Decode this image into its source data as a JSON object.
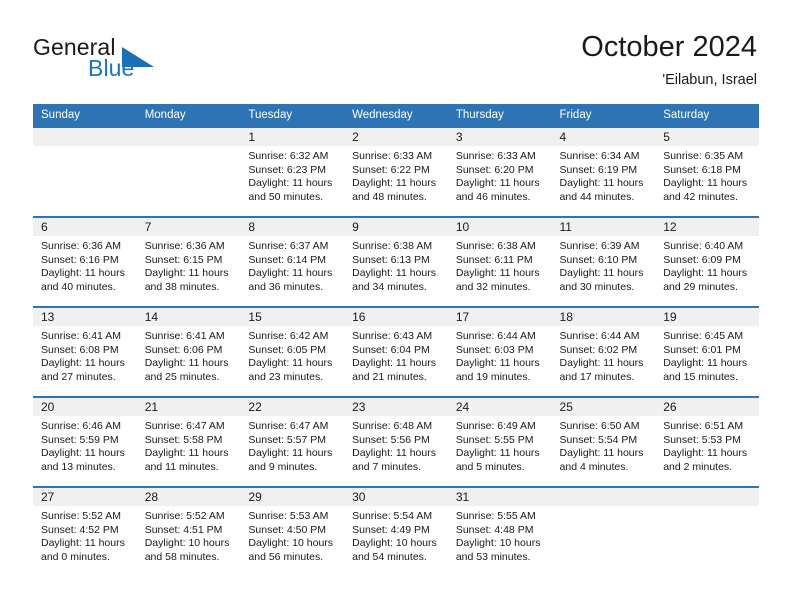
{
  "logo": {
    "word_one": "General",
    "word_two": "Blue",
    "triangle_color": "#1b6fb5",
    "text_color": "#1a1a1a",
    "blue_color": "#1b75bb",
    "icon": "general-blue-logo"
  },
  "header": {
    "title": "October 2024",
    "subtitle": "'Eilabun, Israel",
    "accent_color": "#2e74b5",
    "day_band_color": "#f0f0f0"
  },
  "weekday_headers": [
    "Sunday",
    "Monday",
    "Tuesday",
    "Wednesday",
    "Thursday",
    "Friday",
    "Saturday"
  ],
  "labels": {
    "sunrise_prefix": "Sunrise:",
    "sunset_prefix": "Sunset:",
    "daylight_prefix": "Daylight:"
  },
  "weeks": [
    [
      {
        "day": "",
        "empty": true
      },
      {
        "day": "",
        "empty": true
      },
      {
        "day": "1",
        "sunrise": "Sunrise: 6:32 AM",
        "sunset": "Sunset: 6:23 PM",
        "daylight_line1": "Daylight: 11 hours",
        "daylight_line2": "and 50 minutes."
      },
      {
        "day": "2",
        "sunrise": "Sunrise: 6:33 AM",
        "sunset": "Sunset: 6:22 PM",
        "daylight_line1": "Daylight: 11 hours",
        "daylight_line2": "and 48 minutes."
      },
      {
        "day": "3",
        "sunrise": "Sunrise: 6:33 AM",
        "sunset": "Sunset: 6:20 PM",
        "daylight_line1": "Daylight: 11 hours",
        "daylight_line2": "and 46 minutes."
      },
      {
        "day": "4",
        "sunrise": "Sunrise: 6:34 AM",
        "sunset": "Sunset: 6:19 PM",
        "daylight_line1": "Daylight: 11 hours",
        "daylight_line2": "and 44 minutes."
      },
      {
        "day": "5",
        "sunrise": "Sunrise: 6:35 AM",
        "sunset": "Sunset: 6:18 PM",
        "daylight_line1": "Daylight: 11 hours",
        "daylight_line2": "and 42 minutes."
      }
    ],
    [
      {
        "day": "6",
        "sunrise": "Sunrise: 6:36 AM",
        "sunset": "Sunset: 6:16 PM",
        "daylight_line1": "Daylight: 11 hours",
        "daylight_line2": "and 40 minutes."
      },
      {
        "day": "7",
        "sunrise": "Sunrise: 6:36 AM",
        "sunset": "Sunset: 6:15 PM",
        "daylight_line1": "Daylight: 11 hours",
        "daylight_line2": "and 38 minutes."
      },
      {
        "day": "8",
        "sunrise": "Sunrise: 6:37 AM",
        "sunset": "Sunset: 6:14 PM",
        "daylight_line1": "Daylight: 11 hours",
        "daylight_line2": "and 36 minutes."
      },
      {
        "day": "9",
        "sunrise": "Sunrise: 6:38 AM",
        "sunset": "Sunset: 6:13 PM",
        "daylight_line1": "Daylight: 11 hours",
        "daylight_line2": "and 34 minutes."
      },
      {
        "day": "10",
        "sunrise": "Sunrise: 6:38 AM",
        "sunset": "Sunset: 6:11 PM",
        "daylight_line1": "Daylight: 11 hours",
        "daylight_line2": "and 32 minutes."
      },
      {
        "day": "11",
        "sunrise": "Sunrise: 6:39 AM",
        "sunset": "Sunset: 6:10 PM",
        "daylight_line1": "Daylight: 11 hours",
        "daylight_line2": "and 30 minutes."
      },
      {
        "day": "12",
        "sunrise": "Sunrise: 6:40 AM",
        "sunset": "Sunset: 6:09 PM",
        "daylight_line1": "Daylight: 11 hours",
        "daylight_line2": "and 29 minutes."
      }
    ],
    [
      {
        "day": "13",
        "sunrise": "Sunrise: 6:41 AM",
        "sunset": "Sunset: 6:08 PM",
        "daylight_line1": "Daylight: 11 hours",
        "daylight_line2": "and 27 minutes."
      },
      {
        "day": "14",
        "sunrise": "Sunrise: 6:41 AM",
        "sunset": "Sunset: 6:06 PM",
        "daylight_line1": "Daylight: 11 hours",
        "daylight_line2": "and 25 minutes."
      },
      {
        "day": "15",
        "sunrise": "Sunrise: 6:42 AM",
        "sunset": "Sunset: 6:05 PM",
        "daylight_line1": "Daylight: 11 hours",
        "daylight_line2": "and 23 minutes."
      },
      {
        "day": "16",
        "sunrise": "Sunrise: 6:43 AM",
        "sunset": "Sunset: 6:04 PM",
        "daylight_line1": "Daylight: 11 hours",
        "daylight_line2": "and 21 minutes."
      },
      {
        "day": "17",
        "sunrise": "Sunrise: 6:44 AM",
        "sunset": "Sunset: 6:03 PM",
        "daylight_line1": "Daylight: 11 hours",
        "daylight_line2": "and 19 minutes."
      },
      {
        "day": "18",
        "sunrise": "Sunrise: 6:44 AM",
        "sunset": "Sunset: 6:02 PM",
        "daylight_line1": "Daylight: 11 hours",
        "daylight_line2": "and 17 minutes."
      },
      {
        "day": "19",
        "sunrise": "Sunrise: 6:45 AM",
        "sunset": "Sunset: 6:01 PM",
        "daylight_line1": "Daylight: 11 hours",
        "daylight_line2": "and 15 minutes."
      }
    ],
    [
      {
        "day": "20",
        "sunrise": "Sunrise: 6:46 AM",
        "sunset": "Sunset: 5:59 PM",
        "daylight_line1": "Daylight: 11 hours",
        "daylight_line2": "and 13 minutes."
      },
      {
        "day": "21",
        "sunrise": "Sunrise: 6:47 AM",
        "sunset": "Sunset: 5:58 PM",
        "daylight_line1": "Daylight: 11 hours",
        "daylight_line2": "and 11 minutes."
      },
      {
        "day": "22",
        "sunrise": "Sunrise: 6:47 AM",
        "sunset": "Sunset: 5:57 PM",
        "daylight_line1": "Daylight: 11 hours",
        "daylight_line2": "and 9 minutes."
      },
      {
        "day": "23",
        "sunrise": "Sunrise: 6:48 AM",
        "sunset": "Sunset: 5:56 PM",
        "daylight_line1": "Daylight: 11 hours",
        "daylight_line2": "and 7 minutes."
      },
      {
        "day": "24",
        "sunrise": "Sunrise: 6:49 AM",
        "sunset": "Sunset: 5:55 PM",
        "daylight_line1": "Daylight: 11 hours",
        "daylight_line2": "and 5 minutes."
      },
      {
        "day": "25",
        "sunrise": "Sunrise: 6:50 AM",
        "sunset": "Sunset: 5:54 PM",
        "daylight_line1": "Daylight: 11 hours",
        "daylight_line2": "and 4 minutes."
      },
      {
        "day": "26",
        "sunrise": "Sunrise: 6:51 AM",
        "sunset": "Sunset: 5:53 PM",
        "daylight_line1": "Daylight: 11 hours",
        "daylight_line2": "and 2 minutes."
      }
    ],
    [
      {
        "day": "27",
        "sunrise": "Sunrise: 5:52 AM",
        "sunset": "Sunset: 4:52 PM",
        "daylight_line1": "Daylight: 11 hours",
        "daylight_line2": "and 0 minutes."
      },
      {
        "day": "28",
        "sunrise": "Sunrise: 5:52 AM",
        "sunset": "Sunset: 4:51 PM",
        "daylight_line1": "Daylight: 10 hours",
        "daylight_line2": "and 58 minutes."
      },
      {
        "day": "29",
        "sunrise": "Sunrise: 5:53 AM",
        "sunset": "Sunset: 4:50 PM",
        "daylight_line1": "Daylight: 10 hours",
        "daylight_line2": "and 56 minutes."
      },
      {
        "day": "30",
        "sunrise": "Sunrise: 5:54 AM",
        "sunset": "Sunset: 4:49 PM",
        "daylight_line1": "Daylight: 10 hours",
        "daylight_line2": "and 54 minutes."
      },
      {
        "day": "31",
        "sunrise": "Sunrise: 5:55 AM",
        "sunset": "Sunset: 4:48 PM",
        "daylight_line1": "Daylight: 10 hours",
        "daylight_line2": "and 53 minutes."
      },
      {
        "day": "",
        "empty": true
      },
      {
        "day": "",
        "empty": true
      }
    ]
  ]
}
